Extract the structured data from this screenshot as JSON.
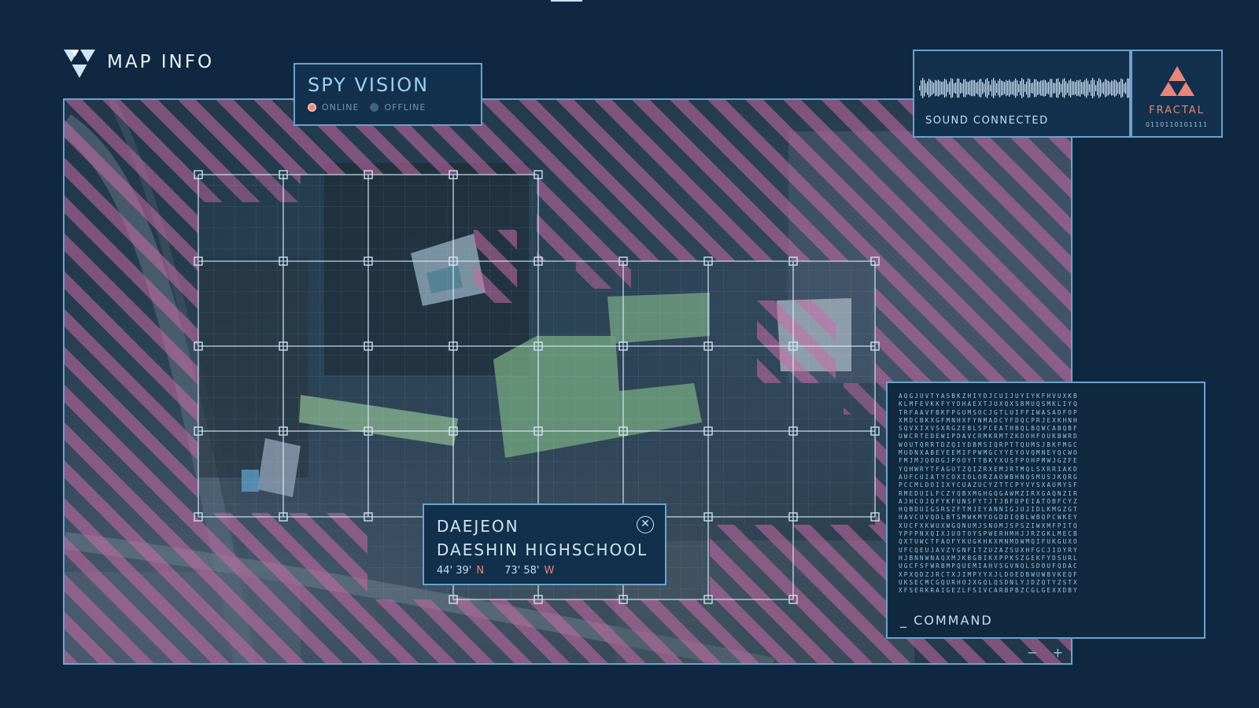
{
  "header": {
    "title": "MAP INFO",
    "logo_icon": "triangle-cluster-icon"
  },
  "spy_vision": {
    "title": "SPY VISION",
    "statuses": [
      {
        "label": "ONLINE",
        "color": "#e8867a",
        "active": true
      },
      {
        "label": "OFFLINE",
        "color": "#3f6480",
        "active": false
      }
    ]
  },
  "sound": {
    "label": "SOUND CONNECTED",
    "wave_icon": "audio-waveform-icon"
  },
  "fractal": {
    "name": "FRACTAL",
    "code": "0110110101111",
    "icon": "triangle-cluster-icon",
    "color": "#e8867a"
  },
  "location": {
    "city": "DAEJEON",
    "place": "DAESHIN HIGHSCHOOL",
    "lat": "44' 39'",
    "lat_dir": "N",
    "lon": "73' 58'",
    "lon_dir": "W",
    "close_icon": "close-circle-icon"
  },
  "command": {
    "label": "_ COMMAND",
    "lines": [
      "AQGJUVTYASBKZHIYDJCUIJUYIYKFHVUXKB",
      "KLMFEVKKFYYDHAEXTJUXQXSBMUQSMKLIYQ",
      "TRFAAVFBKFPGUMSOCJGTLUIFFIWASADFOP",
      "XMDCBKXGFMNHXFYNMADCYFDQCPRJEXKHNH",
      "SQVXIXVSXRGZEBLSPCEATHBQLBQWCABQBF",
      "UWCRTEDEWIPDAVCRMKRMTZKDOHFOUKBWRD",
      "WOUTQRRTDZQIYDBMSIQRPTTQUMSJBKFMGC",
      "MUDNXABEYEEMIFPWMGCYYEYOVQMNEYQCWO",
      "FMJMJQODGJPOOYTTBKYXUSFPOHPMWJGZFE",
      "YQHWRYTFAGUTZQIZRXEMJRTMQLSXRRIAKD",
      "AUFCUIATYCOXIOLORZAOWBHNQSMUSJKQRG",
      "PCCMLDOIIXYCUAZUCYZTTCPYVYSXAUMYSF",
      "RMEDUILFCZYQBXMGHGQGAWMZIRXGAQNZIR",
      "AJHCOJQFYKFUNSFYTJTJBFDPEIATOBFCYZ",
      "HQBDUIGSRSZFTMJEYANNIGJUJIDLKMGZGT",
      "HAVCUVQDLBTSMWKMYOGDDIQBLWBQPCWKEY",
      "XUCFXKWUXWGQNUMJSNOMJSPSZIWXMFPITQ",
      "YPFPNXQIXJUOTOYSPWERHMHJJRZGKLMECB",
      "QXTUWCTFAOFYKUGKHKXMNMDWMQIFUKGUXO",
      "UFCQEUJAVZYGNFITZUZAZSUXHFGCJIDYRY",
      "HJBNNWNAQXMJKBGBIKXPPKSZGEKFYDSURL",
      "UGCFSFWRBMPQUEMIAHVSGVNQLSDOUFQDAC",
      "XPXQDZJRCTXJIMPYYXJLDOEDBWUWBVKEQF",
      "UKSECMCGQURHOJXGQLQSDNLYJDZQTYZSTX",
      "XFSERKRAIGEZLFSIVCARBPBZCGLGEXXDBY"
    ]
  },
  "map": {
    "zoom_out": "−",
    "zoom_in": "+",
    "hatch_color": "#c86aa6",
    "grid_color": "#cfe6f7"
  }
}
